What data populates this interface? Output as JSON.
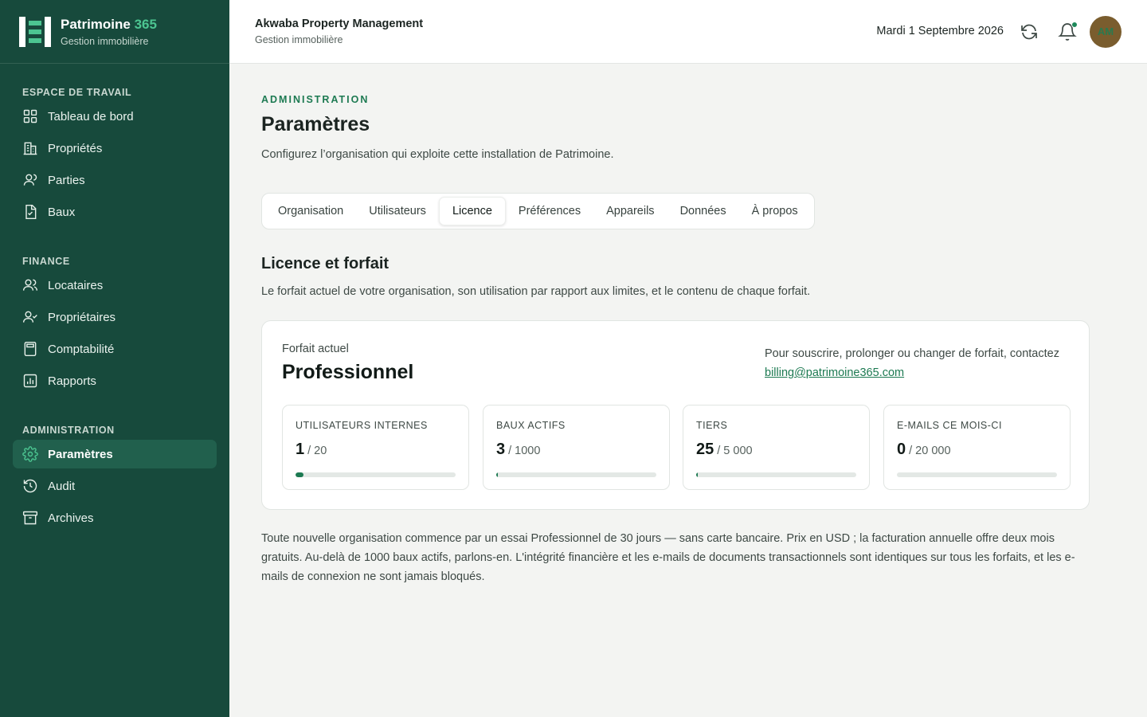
{
  "brand": {
    "name": "Patrimoine",
    "name_accent": "365",
    "subtitle": "Gestion immobilière"
  },
  "sidebar": {
    "sections": [
      {
        "title": "ESPACE DE TRAVAIL",
        "items": [
          {
            "label": "Tableau de bord",
            "icon": "grid-icon"
          },
          {
            "label": "Propriétés",
            "icon": "building-icon"
          },
          {
            "label": "Parties",
            "icon": "user-icon"
          },
          {
            "label": "Baux",
            "icon": "document-icon"
          }
        ]
      },
      {
        "title": "FINANCE",
        "items": [
          {
            "label": "Locataires",
            "icon": "users-icon"
          },
          {
            "label": "Propriétaires",
            "icon": "user-check-icon"
          },
          {
            "label": "Comptabilité",
            "icon": "calculator-icon"
          },
          {
            "label": "Rapports",
            "icon": "chart-icon"
          }
        ]
      },
      {
        "title": "ADMINISTRATION",
        "items": [
          {
            "label": "Paramètres",
            "icon": "gear-icon",
            "active": true
          },
          {
            "label": "Audit",
            "icon": "history-icon"
          },
          {
            "label": "Archives",
            "icon": "archive-icon"
          }
        ]
      }
    ]
  },
  "topbar": {
    "org_name": "Akwaba Property Management",
    "org_subtitle": "Gestion immobilière",
    "date": "Mardi 1 Septembre 2026",
    "avatar_initials": "AM"
  },
  "page": {
    "eyebrow": "ADMINISTRATION",
    "title": "Paramètres",
    "description": "Configurez l’organisation qui exploite cette installation de Patrimoine."
  },
  "tabs": [
    {
      "label": "Organisation",
      "active": false
    },
    {
      "label": "Utilisateurs",
      "active": false
    },
    {
      "label": "Licence",
      "active": true
    },
    {
      "label": "Préférences",
      "active": false
    },
    {
      "label": "Appareils",
      "active": false
    },
    {
      "label": "Données",
      "active": false
    },
    {
      "label": "À propos",
      "active": false
    }
  ],
  "license": {
    "title": "Licence et forfait",
    "description": "Le forfait actuel de votre organisation, son utilisation par rapport aux limites, et le contenu de chaque forfait.",
    "plan_label": "Forfait actuel",
    "plan_name": "Professionnel",
    "contact_text": "Pour souscrire, prolonger ou changer de forfait, contactez",
    "contact_email": "billing@patrimoine365.com",
    "metrics": [
      {
        "label": "UTILISATEURS INTERNES",
        "value": "1",
        "limit": "/ 20",
        "fraction": 0.05
      },
      {
        "label": "BAUX ACTIFS",
        "value": "3",
        "limit": "/ 1000",
        "fraction": 0.003
      },
      {
        "label": "TIERS",
        "value": "25",
        "limit": "/ 5 000",
        "fraction": 0.005
      },
      {
        "label": "E-MAILS CE MOIS-CI",
        "value": "0",
        "limit": "/ 20 000",
        "fraction": 0
      }
    ],
    "footer_note": "Toute nouvelle organisation commence par un essai Professionnel de 30 jours — sans carte bancaire. Prix en USD ; la facturation annuelle offre deux mois gratuits. Au-delà de 1000 baux actifs, parlons-en. L'intégrité financière et les e-mails de documents transactionnels sont identiques sur tous les forfaits, et les e-mails de connexion ne sont jamais bloqués."
  },
  "colors": {
    "sidebar_bg": "#174a3c",
    "accent": "#1d7a52",
    "brand_accent": "#4cc591",
    "active_nav": "#21604d"
  }
}
